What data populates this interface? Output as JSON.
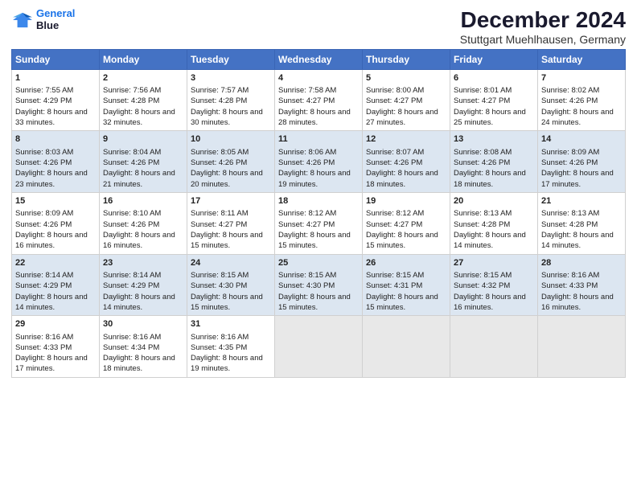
{
  "logo": {
    "line1": "General",
    "line2": "Blue"
  },
  "title": "December 2024",
  "subtitle": "Stuttgart Muehlhausen, Germany",
  "days_header": [
    "Sunday",
    "Monday",
    "Tuesday",
    "Wednesday",
    "Thursday",
    "Friday",
    "Saturday"
  ],
  "weeks": [
    [
      {
        "day": "1",
        "sunrise": "Sunrise: 7:55 AM",
        "sunset": "Sunset: 4:29 PM",
        "daylight": "Daylight: 8 hours and 33 minutes."
      },
      {
        "day": "2",
        "sunrise": "Sunrise: 7:56 AM",
        "sunset": "Sunset: 4:28 PM",
        "daylight": "Daylight: 8 hours and 32 minutes."
      },
      {
        "day": "3",
        "sunrise": "Sunrise: 7:57 AM",
        "sunset": "Sunset: 4:28 PM",
        "daylight": "Daylight: 8 hours and 30 minutes."
      },
      {
        "day": "4",
        "sunrise": "Sunrise: 7:58 AM",
        "sunset": "Sunset: 4:27 PM",
        "daylight": "Daylight: 8 hours and 28 minutes."
      },
      {
        "day": "5",
        "sunrise": "Sunrise: 8:00 AM",
        "sunset": "Sunset: 4:27 PM",
        "daylight": "Daylight: 8 hours and 27 minutes."
      },
      {
        "day": "6",
        "sunrise": "Sunrise: 8:01 AM",
        "sunset": "Sunset: 4:27 PM",
        "daylight": "Daylight: 8 hours and 25 minutes."
      },
      {
        "day": "7",
        "sunrise": "Sunrise: 8:02 AM",
        "sunset": "Sunset: 4:26 PM",
        "daylight": "Daylight: 8 hours and 24 minutes."
      }
    ],
    [
      {
        "day": "8",
        "sunrise": "Sunrise: 8:03 AM",
        "sunset": "Sunset: 4:26 PM",
        "daylight": "Daylight: 8 hours and 23 minutes."
      },
      {
        "day": "9",
        "sunrise": "Sunrise: 8:04 AM",
        "sunset": "Sunset: 4:26 PM",
        "daylight": "Daylight: 8 hours and 21 minutes."
      },
      {
        "day": "10",
        "sunrise": "Sunrise: 8:05 AM",
        "sunset": "Sunset: 4:26 PM",
        "daylight": "Daylight: 8 hours and 20 minutes."
      },
      {
        "day": "11",
        "sunrise": "Sunrise: 8:06 AM",
        "sunset": "Sunset: 4:26 PM",
        "daylight": "Daylight: 8 hours and 19 minutes."
      },
      {
        "day": "12",
        "sunrise": "Sunrise: 8:07 AM",
        "sunset": "Sunset: 4:26 PM",
        "daylight": "Daylight: 8 hours and 18 minutes."
      },
      {
        "day": "13",
        "sunrise": "Sunrise: 8:08 AM",
        "sunset": "Sunset: 4:26 PM",
        "daylight": "Daylight: 8 hours and 18 minutes."
      },
      {
        "day": "14",
        "sunrise": "Sunrise: 8:09 AM",
        "sunset": "Sunset: 4:26 PM",
        "daylight": "Daylight: 8 hours and 17 minutes."
      }
    ],
    [
      {
        "day": "15",
        "sunrise": "Sunrise: 8:09 AM",
        "sunset": "Sunset: 4:26 PM",
        "daylight": "Daylight: 8 hours and 16 minutes."
      },
      {
        "day": "16",
        "sunrise": "Sunrise: 8:10 AM",
        "sunset": "Sunset: 4:26 PM",
        "daylight": "Daylight: 8 hours and 16 minutes."
      },
      {
        "day": "17",
        "sunrise": "Sunrise: 8:11 AM",
        "sunset": "Sunset: 4:27 PM",
        "daylight": "Daylight: 8 hours and 15 minutes."
      },
      {
        "day": "18",
        "sunrise": "Sunrise: 8:12 AM",
        "sunset": "Sunset: 4:27 PM",
        "daylight": "Daylight: 8 hours and 15 minutes."
      },
      {
        "day": "19",
        "sunrise": "Sunrise: 8:12 AM",
        "sunset": "Sunset: 4:27 PM",
        "daylight": "Daylight: 8 hours and 15 minutes."
      },
      {
        "day": "20",
        "sunrise": "Sunrise: 8:13 AM",
        "sunset": "Sunset: 4:28 PM",
        "daylight": "Daylight: 8 hours and 14 minutes."
      },
      {
        "day": "21",
        "sunrise": "Sunrise: 8:13 AM",
        "sunset": "Sunset: 4:28 PM",
        "daylight": "Daylight: 8 hours and 14 minutes."
      }
    ],
    [
      {
        "day": "22",
        "sunrise": "Sunrise: 8:14 AM",
        "sunset": "Sunset: 4:29 PM",
        "daylight": "Daylight: 8 hours and 14 minutes."
      },
      {
        "day": "23",
        "sunrise": "Sunrise: 8:14 AM",
        "sunset": "Sunset: 4:29 PM",
        "daylight": "Daylight: 8 hours and 14 minutes."
      },
      {
        "day": "24",
        "sunrise": "Sunrise: 8:15 AM",
        "sunset": "Sunset: 4:30 PM",
        "daylight": "Daylight: 8 hours and 15 minutes."
      },
      {
        "day": "25",
        "sunrise": "Sunrise: 8:15 AM",
        "sunset": "Sunset: 4:30 PM",
        "daylight": "Daylight: 8 hours and 15 minutes."
      },
      {
        "day": "26",
        "sunrise": "Sunrise: 8:15 AM",
        "sunset": "Sunset: 4:31 PM",
        "daylight": "Daylight: 8 hours and 15 minutes."
      },
      {
        "day": "27",
        "sunrise": "Sunrise: 8:15 AM",
        "sunset": "Sunset: 4:32 PM",
        "daylight": "Daylight: 8 hours and 16 minutes."
      },
      {
        "day": "28",
        "sunrise": "Sunrise: 8:16 AM",
        "sunset": "Sunset: 4:33 PM",
        "daylight": "Daylight: 8 hours and 16 minutes."
      }
    ],
    [
      {
        "day": "29",
        "sunrise": "Sunrise: 8:16 AM",
        "sunset": "Sunset: 4:33 PM",
        "daylight": "Daylight: 8 hours and 17 minutes."
      },
      {
        "day": "30",
        "sunrise": "Sunrise: 8:16 AM",
        "sunset": "Sunset: 4:34 PM",
        "daylight": "Daylight: 8 hours and 18 minutes."
      },
      {
        "day": "31",
        "sunrise": "Sunrise: 8:16 AM",
        "sunset": "Sunset: 4:35 PM",
        "daylight": "Daylight: 8 hours and 19 minutes."
      },
      null,
      null,
      null,
      null
    ]
  ]
}
